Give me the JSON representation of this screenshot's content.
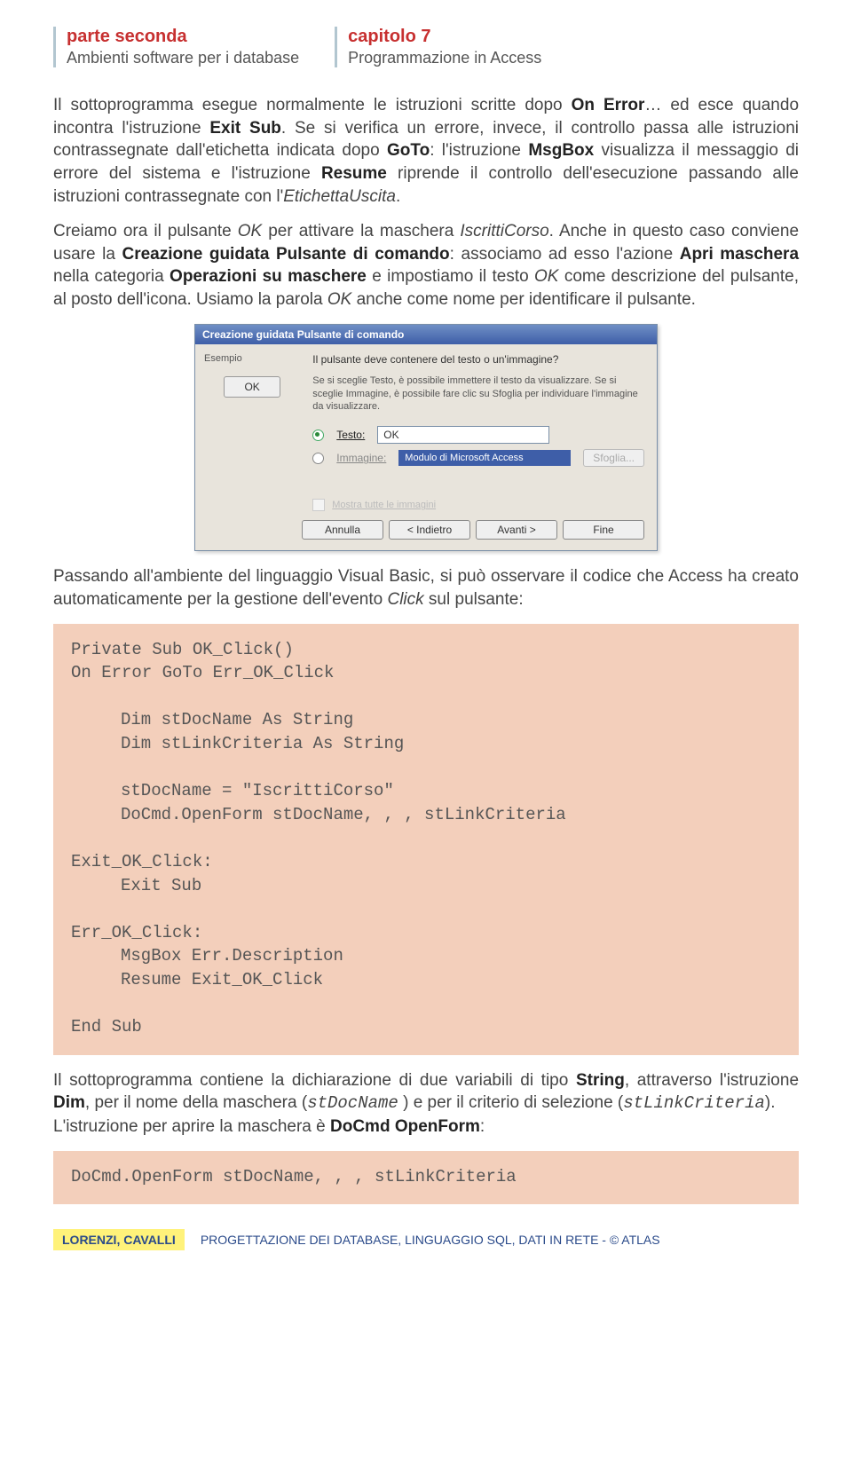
{
  "header": {
    "part_title": "parte seconda",
    "part_sub": "Ambienti software per i database",
    "chap_title": "capitolo 7",
    "chap_sub": "Programmazione in Access"
  },
  "para1_a": "Il sottoprogramma esegue normalmente le istruzioni scritte dopo ",
  "para1_b": "On Error",
  "para1_c": "… ed esce quando incontra l'istruzione ",
  "para1_d": "Exit Sub",
  "para1_e": ". Se si verifica un errore, invece, il controllo passa alle istruzioni contrassegnate dall'etichetta indicata dopo ",
  "para1_f": "GoTo",
  "para1_g": ": l'istruzione ",
  "para1_h": "MsgBox",
  "para1_i": " visualizza il messaggio di errore del sistema e l'istruzione ",
  "para1_j": "Resume",
  "para1_k": " riprende il controllo dell'esecuzione passando alle istruzioni contrassegnate con l'",
  "para1_l": "EtichettaUscita",
  "para1_m": ".",
  "para2_a": "Creiamo ora il pulsante ",
  "para2_b": "OK",
  "para2_c": " per attivare la maschera ",
  "para2_d": "IscrittiCorso",
  "para2_e": ". Anche in questo caso conviene usare la ",
  "para2_f": "Creazione guidata Pulsante di comando",
  "para2_g": ": associamo ad esso l'azione ",
  "para2_h": "Apri maschera",
  "para2_i": " nella categoria ",
  "para2_j": "Operazioni su maschere",
  "para2_k": " e impostiamo il testo ",
  "para2_l": "OK",
  "para2_m": " come descrizione del pulsante, al posto dell'icona. Usiamo la parola ",
  "para2_n": "OK",
  "para2_o": " anche come nome per identificare il pulsante.",
  "dialog": {
    "title": "Creazione guidata Pulsante di comando",
    "preview_label": "Esempio",
    "preview_button": "OK",
    "question": "Il pulsante deve contenere del testo o un'immagine?",
    "hint": "Se si sceglie Testo, è possibile immettere il testo da visualizzare. Se si sceglie Immagine, è possibile fare clic su Sfoglia per individuare l'immagine da visualizzare.",
    "opt_text_label": "Testo:",
    "opt_text_value": "OK",
    "opt_img_label": "Immagine:",
    "opt_img_value": "Modulo di Microsoft Access",
    "browse": "Sfoglia...",
    "show_all": "Mostra tutte le immagini",
    "btn_cancel": "Annulla",
    "btn_back": "< Indietro",
    "btn_next": "Avanti >",
    "btn_finish": "Fine"
  },
  "para3_a": "Passando all'ambiente del linguaggio Visual Basic, si può osservare il codice che Access ha creato automaticamente per la gestione dell'evento ",
  "para3_b": "Click",
  "para3_c": " sul pulsante:",
  "code1": {
    "l1": "Private Sub OK_Click()",
    "l2": "On Error GoTo Err_OK_Click",
    "l3": "Dim stDocName As String",
    "l4": "Dim stLinkCriteria As String",
    "l5": "stDocName = \"IscrittiCorso\"",
    "l6": "DoCmd.OpenForm stDocName, , , stLinkCriteria",
    "l7": "Exit_OK_Click:",
    "l8": "Exit Sub",
    "l9": "Err_OK_Click:",
    "l10": "MsgBox Err.Description",
    "l11": "Resume Exit_OK_Click",
    "l12": "End Sub"
  },
  "para4_a": "Il sottoprogramma contiene la dichiarazione di due variabili di tipo ",
  "para4_b": "String",
  "para4_c": ", attraverso l'istruzione ",
  "para4_d": "Dim",
  "para4_e": ", per il nome della maschera (",
  "para4_f": "stDocName",
  "para4_g": " ) e per il criterio di selezione (",
  "para4_h": "stLinkCriteria",
  "para4_i": ").",
  "para5_a": "L'istruzione per aprire la maschera è ",
  "para5_b": " DoCmd OpenForm",
  "para5_c": ":",
  "code2": "DoCmd.OpenForm stDocName, , , stLinkCriteria",
  "footer": {
    "author": "LORENZI, CAVALLI",
    "book": "PROGETTAZIONE DEI DATABASE, LINGUAGGIO SQL, DATI IN RETE - © ATLAS"
  }
}
